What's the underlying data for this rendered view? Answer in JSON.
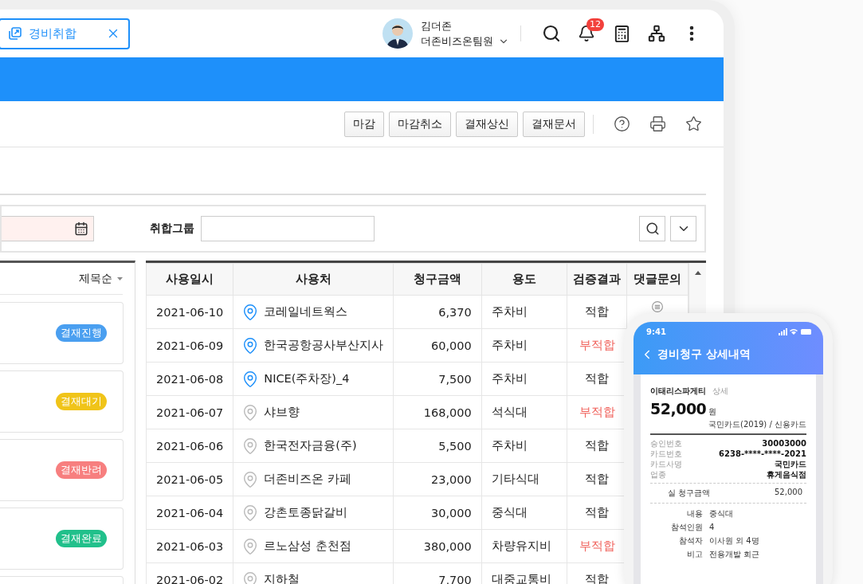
{
  "tab": {
    "label": "경비취합"
  },
  "user": {
    "name": "김더존",
    "team": "더존비즈온팀원",
    "notifications": "12"
  },
  "actions": [
    "마감",
    "마감취소",
    "결재상신",
    "결재문서"
  ],
  "filter": {
    "group_label": "취합그룹"
  },
  "sort": {
    "label": "제목순"
  },
  "cards": [
    {
      "status": "결재진행",
      "color": "#4a9ff0"
    },
    {
      "status": "결재대기",
      "color": "#f0c419"
    },
    {
      "status": "결재반려",
      "color": "#f77f7f"
    },
    {
      "status": "결재완료",
      "color": "#21c08b"
    }
  ],
  "table": {
    "columns": [
      "사용일시",
      "사용처",
      "청구금액",
      "용도",
      "검증결과",
      "댓글문의"
    ],
    "rows": [
      {
        "date": "2021-06-10",
        "place": "코레일네트웍스",
        "located": true,
        "amount": "6,370",
        "use": "주차비",
        "result": "적합",
        "flagged": false,
        "comment": true
      },
      {
        "date": "2021-06-09",
        "place": "한국공항공사부산지사",
        "located": true,
        "amount": "60,000",
        "use": "주차비",
        "result": "부적합",
        "flagged": true,
        "comment": false
      },
      {
        "date": "2021-06-08",
        "place": "NICE(주차장)_4",
        "located": true,
        "amount": "7,500",
        "use": "주차비",
        "result": "적합",
        "flagged": false,
        "comment": false
      },
      {
        "date": "2021-06-07",
        "place": "샤브향",
        "located": false,
        "amount": "168,000",
        "use": "석식대",
        "result": "부적합",
        "flagged": true,
        "comment": false
      },
      {
        "date": "2021-06-06",
        "place": "한국전자금융(주)",
        "located": false,
        "amount": "5,500",
        "use": "주차비",
        "result": "적합",
        "flagged": false,
        "comment": false
      },
      {
        "date": "2021-06-05",
        "place": "더존비즈온 카페",
        "located": false,
        "amount": "23,000",
        "use": "기타식대",
        "result": "적합",
        "flagged": false,
        "comment": false
      },
      {
        "date": "2021-06-04",
        "place": "강촌토종닭갈비",
        "located": false,
        "amount": "30,000",
        "use": "중식대",
        "result": "적합",
        "flagged": false,
        "comment": false
      },
      {
        "date": "2021-06-03",
        "place": "르노삼성 춘천점",
        "located": false,
        "amount": "380,000",
        "use": "차량유지비",
        "result": "부적합",
        "flagged": true,
        "comment": false
      },
      {
        "date": "2021-06-02",
        "place": "지하철",
        "located": false,
        "amount": "7,700",
        "use": "대중교통비",
        "result": "적합",
        "flagged": false,
        "comment": false
      }
    ]
  },
  "phone": {
    "time": "9:41",
    "title": "경비청구 상세내역",
    "merchant": "이태리스파게티",
    "detail_link": "상세",
    "amount": "52,000",
    "currency": "원",
    "card": "국민카드(2019) / 신용카드",
    "card_info": [
      {
        "label": "승인번호",
        "value": "30003000"
      },
      {
        "label": "카드번호",
        "value": "6238-****-****-2021"
      },
      {
        "label": "카드사명",
        "value": "국민카드"
      },
      {
        "label": "업종",
        "value": "휴게음식점"
      }
    ],
    "claim": {
      "label": "실 청구금액",
      "value": "52,000"
    },
    "details": [
      {
        "label": "내용",
        "value": "중식대"
      },
      {
        "label": "참석인원",
        "value": "4"
      },
      {
        "label": "참석자",
        "value": "이사원 외 4명"
      },
      {
        "label": "비고",
        "value": "전용개발 회근"
      }
    ]
  }
}
